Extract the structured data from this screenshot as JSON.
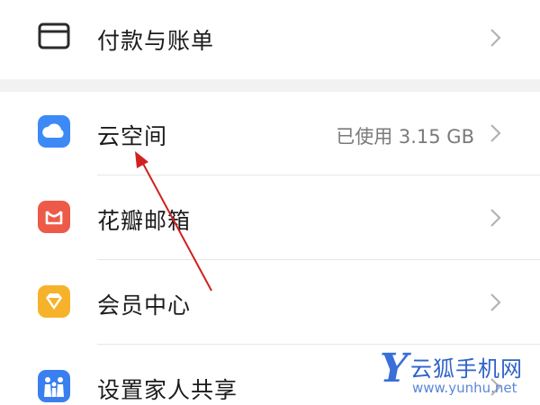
{
  "menu": {
    "payments": {
      "label": "付款与账单",
      "icon": "card-icon"
    },
    "cloud": {
      "label": "云空间",
      "value": "已使用 3.15 GB",
      "icon": "cloud-icon"
    },
    "mail": {
      "label": "花瓣邮箱",
      "icon": "mail-icon"
    },
    "member": {
      "label": "会员中心",
      "icon": "diamond-icon"
    },
    "family": {
      "label": "设置家人共享",
      "icon": "family-icon"
    }
  },
  "watermark": {
    "title": "云狐手机网",
    "url": "www.yunhu.net",
    "letter": "Y"
  },
  "colors": {
    "cloud": "#3d8af7",
    "mail": "#ee5a4a",
    "member": "#f7b22b",
    "family": "#3a7ff0",
    "annotation_arrow": "#d0211f"
  }
}
